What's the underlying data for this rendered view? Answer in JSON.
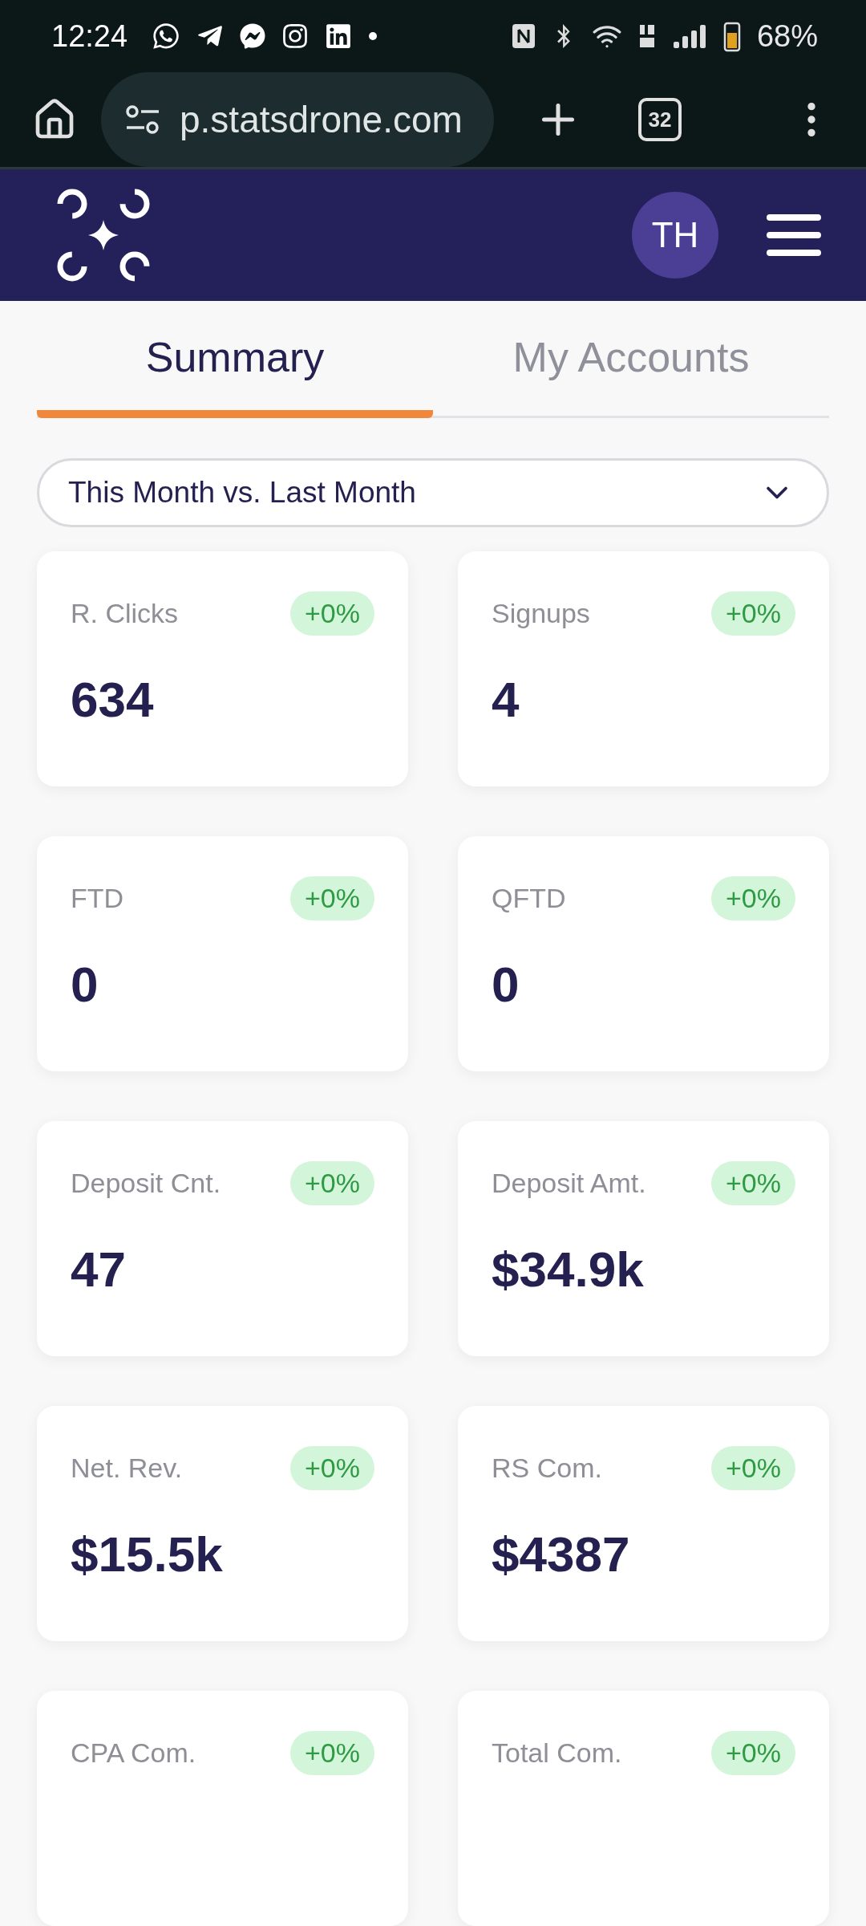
{
  "status_bar": {
    "time": "12:24",
    "battery": "68%"
  },
  "browser": {
    "url": "p.statsdrone.com",
    "tab_count": "32"
  },
  "header": {
    "avatar": "TH"
  },
  "tabs": [
    {
      "label": "Summary",
      "selected": true
    },
    {
      "label": "My Accounts",
      "selected": false
    }
  ],
  "period_select": {
    "value": "This Month vs. Last Month"
  },
  "cards": [
    {
      "label": "R. Clicks",
      "change": "+0%",
      "value": "634"
    },
    {
      "label": "Signups",
      "change": "+0%",
      "value": "4"
    },
    {
      "label": "FTD",
      "change": "+0%",
      "value": "0"
    },
    {
      "label": "QFTD",
      "change": "+0%",
      "value": "0"
    },
    {
      "label": "Deposit Cnt.",
      "change": "+0%",
      "value": "47"
    },
    {
      "label": "Deposit Amt.",
      "change": "+0%",
      "value": "$34.9k"
    },
    {
      "label": "Net. Rev.",
      "change": "+0%",
      "value": "$15.5k"
    },
    {
      "label": "RS Com.",
      "change": "+0%",
      "value": "$4387"
    },
    {
      "label": "CPA Com.",
      "change": "+0%"
    },
    {
      "label": "Total Com.",
      "change": "+0%"
    }
  ]
}
